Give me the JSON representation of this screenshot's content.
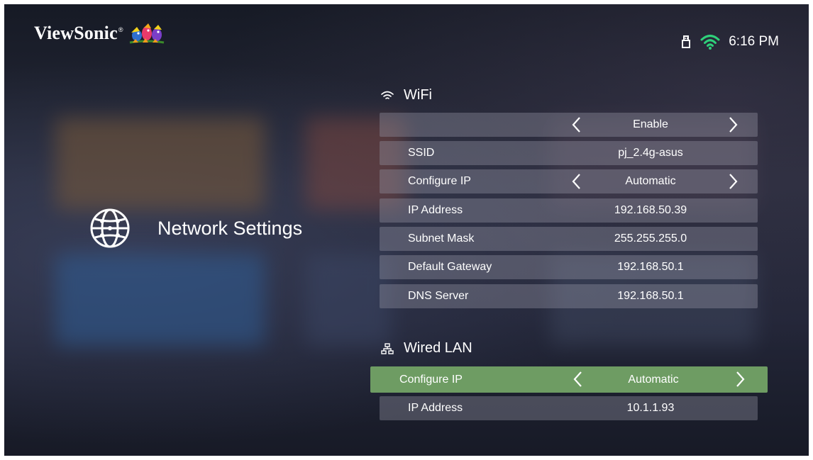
{
  "header": {
    "brand": "ViewSonic",
    "brand_mark": "®",
    "clock": "6:16 PM",
    "icons": [
      "usb-icon",
      "wifi-status-icon"
    ]
  },
  "left_panel": {
    "title": "Network Settings",
    "icon": "globe-icon"
  },
  "wifi": {
    "section_title": "WiFi",
    "icon": "wifi-icon",
    "rows": [
      {
        "label": "",
        "value": "Enable"
      },
      {
        "label": "SSID",
        "value": "pj_2.4g-asus"
      },
      {
        "label": "Configure IP",
        "value": "Automatic"
      },
      {
        "label": "IP Address",
        "value": "192.168.50.39"
      },
      {
        "label": "Subnet Mask",
        "value": "255.255.255.0"
      },
      {
        "label": "Default Gateway",
        "value": "192.168.50.1"
      },
      {
        "label": "DNS Server",
        "value": "192.168.50.1"
      }
    ]
  },
  "wired_lan": {
    "section_title": "Wired LAN",
    "icon": "lan-icon",
    "rows": [
      {
        "label": "Configure IP",
        "value": "Automatic"
      },
      {
        "label": "IP Address",
        "value": "10.1.1.93"
      }
    ]
  },
  "colors": {
    "highlight": "#6e9c63",
    "row_background": "rgba(150,150,165,0.38)",
    "text": "#ffffff"
  }
}
